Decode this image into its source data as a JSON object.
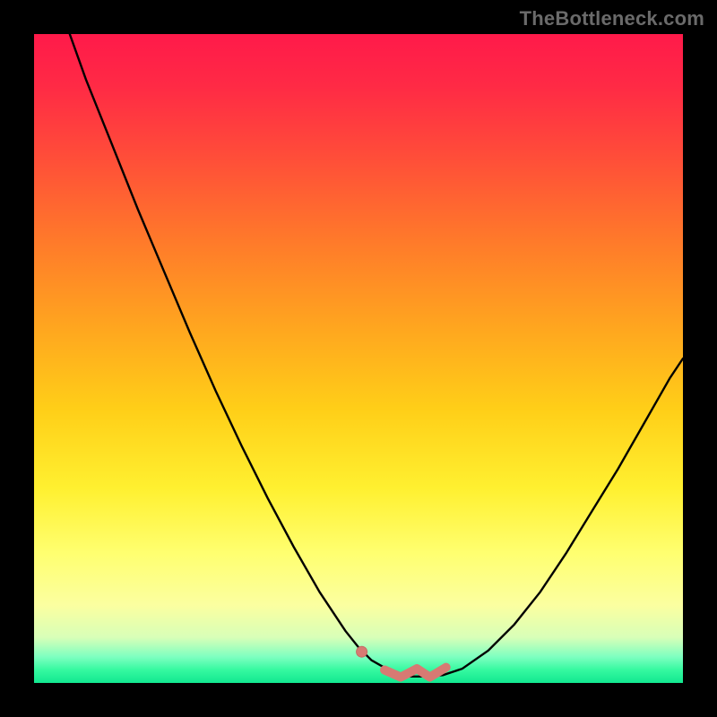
{
  "attribution": "TheBottleneck.com",
  "colors": {
    "frame": "#000000",
    "curve": "#000000",
    "marker": "#d77a73",
    "marker_stroke": "#c46a63",
    "gradient_top": "#ff1a4a",
    "gradient_bottom": "#12e890"
  },
  "chart_data": {
    "type": "line",
    "title": "",
    "xlabel": "",
    "ylabel": "",
    "xlim": [
      0,
      100
    ],
    "ylim": [
      0,
      100
    ],
    "series": [
      {
        "name": "bottleneck-curve",
        "x": [
          5.5,
          8,
          12,
          16,
          20,
          24,
          28,
          32,
          36,
          40,
          44,
          48,
          50,
          52,
          55,
          58,
          60,
          63,
          66,
          70,
          74,
          78,
          82,
          86,
          90,
          94,
          98,
          100
        ],
        "y": [
          100,
          93,
          83,
          73,
          63.5,
          54,
          45,
          36.5,
          28.5,
          21,
          14,
          8,
          5.5,
          3.5,
          1.8,
          1.0,
          1.0,
          1.2,
          2.2,
          5,
          9,
          14,
          20,
          26.5,
          33,
          40,
          47,
          50
        ]
      }
    ],
    "markers": {
      "circle": {
        "x": 50.5,
        "y": 4.8,
        "r": 6
      },
      "tilde_path": [
        {
          "x": 54,
          "y": 2.0
        },
        {
          "x": 56.5,
          "y": 0.9
        },
        {
          "x": 59,
          "y": 2.2
        },
        {
          "x": 61,
          "y": 0.9
        },
        {
          "x": 63.5,
          "y": 2.4
        }
      ]
    }
  }
}
